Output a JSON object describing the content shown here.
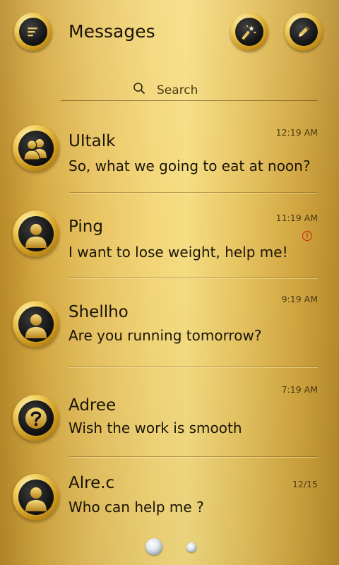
{
  "header": {
    "title": "Messages",
    "menu_icon": "menu-icon",
    "theme_icon": "magic-wand-icon",
    "compose_icon": "pencil-icon"
  },
  "search": {
    "placeholder": "Search",
    "icon": "search-icon"
  },
  "conversations": [
    {
      "name": "UItalk",
      "message": "So, what we going to eat at noon?",
      "time": "12:19 AM",
      "avatar": "group-icon",
      "error": false
    },
    {
      "name": "Ping",
      "message": "I want to lose weight, help me!",
      "time": "11:19 AM",
      "avatar": "person-icon",
      "error": true,
      "error_mark": "!"
    },
    {
      "name": "Shellho",
      "message": "Are you running tomorrow?",
      "time": "9:19 AM",
      "avatar": "person-icon",
      "error": false
    },
    {
      "name": "Adree",
      "message": "Wish the work is smooth",
      "time": "7:19 AM",
      "avatar": "unknown-contact-icon",
      "error": false
    },
    {
      "name": "Alre.c",
      "message": "Who  can  help  me ?",
      "time": "12/15",
      "avatar": "person-icon",
      "error": false
    }
  ],
  "pager": {
    "pages": 2,
    "current": 1
  },
  "colors": {
    "accent_gold": "#e8c463",
    "error_red": "#d21f12",
    "dark_icon": "#151515"
  }
}
